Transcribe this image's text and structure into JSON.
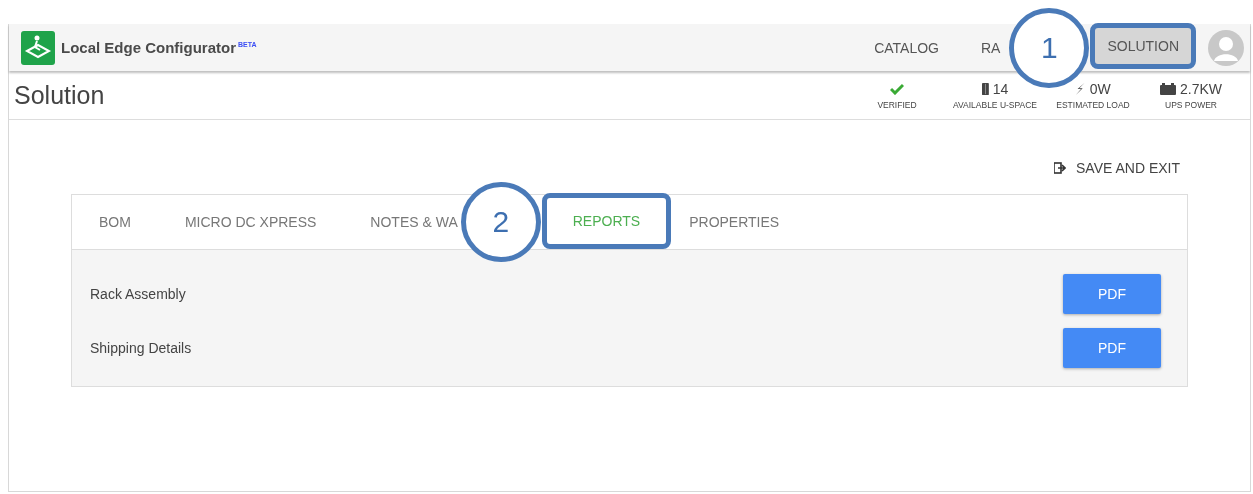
{
  "app": {
    "title": "Local Edge Configurator",
    "badge": "BETA"
  },
  "nav": [
    {
      "label": "CATALOG",
      "selected": false
    },
    {
      "label": "RA",
      "selected": false
    },
    {
      "label": "SOLUTION",
      "selected": true
    }
  ],
  "page_title": "Solution",
  "stats": [
    {
      "kind": "check",
      "label": "VERIFIED"
    },
    {
      "kind": "rack",
      "value": "14",
      "label": "AVAILABLE U-SPACE"
    },
    {
      "kind": "bolt",
      "value": "0W",
      "label": "ESTIMATED LOAD"
    },
    {
      "kind": "battery",
      "value": "2.7KW",
      "label": "UPS POWER"
    }
  ],
  "save_exit": "SAVE AND EXIT",
  "tabs": [
    {
      "label": "BOM",
      "selected": false
    },
    {
      "label": "MICRO DC XPRESS",
      "selected": false
    },
    {
      "label": "NOTES & WA",
      "selected": false
    },
    {
      "label": "REPORTS",
      "selected": true
    },
    {
      "label": "PROPERTIES",
      "selected": false
    }
  ],
  "reports": [
    {
      "name": "Rack Assembly",
      "button": "PDF"
    },
    {
      "name": "Shipping Details",
      "button": "PDF"
    }
  ],
  "callouts": [
    {
      "number": "1"
    },
    {
      "number": "2"
    }
  ]
}
